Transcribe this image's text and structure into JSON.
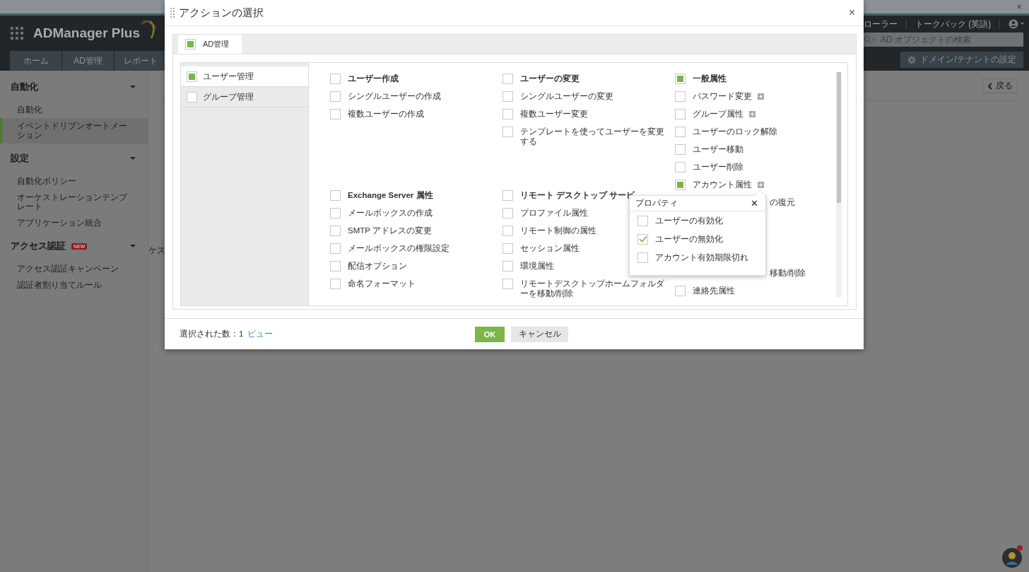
{
  "browser_strip": {
    "close": "×"
  },
  "header": {
    "logo": "ADManager Plus",
    "links": [
      "ローラー",
      "トークバック (英語)"
    ],
    "search": {
      "placeholder": "AD オブジェクトの検索"
    },
    "nav_tabs": [
      {
        "label": "ホーム",
        "selected": false
      },
      {
        "label": "AD管理",
        "selected": false
      },
      {
        "label": "レポート",
        "selected": false
      }
    ],
    "domain_button": "ドメイン/テナントの設定"
  },
  "sidebar": {
    "sections": [
      {
        "title": "自動化",
        "expanded": true,
        "items": [
          {
            "label": "自動化",
            "selected": false
          },
          {
            "label": "イベントドリブンオートメーション",
            "selected": true
          }
        ]
      },
      {
        "title": "設定",
        "expanded": true,
        "items": [
          {
            "label": "自動化ポリシー",
            "selected": false
          },
          {
            "label": "オーケストレーションテンプレート",
            "selected": false
          },
          {
            "label": "アプリケーション統合",
            "selected": false
          }
        ]
      },
      {
        "title": "アクセス認証",
        "badge": "NEW",
        "expanded": true,
        "items": [
          {
            "label": "アクセス認証キャンペーン",
            "selected": false
          },
          {
            "label": "認証者割り当てルール",
            "selected": false
          }
        ]
      }
    ]
  },
  "content": {
    "partial_texts": [
      "ケス"
    ],
    "back_button": "戻る"
  },
  "dialog": {
    "title": "アクションの選択",
    "close": "×",
    "tabs": [
      {
        "label": "AD管理",
        "checked": true,
        "selected": true
      }
    ],
    "categories": [
      {
        "label": "ユーザー管理",
        "checked": true,
        "selected": true
      },
      {
        "label": "グループ管理",
        "checked": false,
        "selected": false
      }
    ],
    "columns": [
      {
        "groups": [
          {
            "title": "ユーザー作成",
            "checked": false,
            "items": [
              {
                "kind": "checkbox",
                "label": "シングルユーザーの作成",
                "checked": false
              },
              {
                "kind": "checkbox",
                "label": "複数ユーザーの作成",
                "checked": false
              }
            ]
          },
          {
            "title": "Exchange Server 属性",
            "checked": false,
            "items": [
              {
                "kind": "checkbox",
                "label": "メールボックスの作成",
                "checked": false
              },
              {
                "kind": "checkbox",
                "label": "SMTP アドレスの変更",
                "checked": false
              },
              {
                "kind": "checkbox",
                "label": "メールボックスの権限設定",
                "checked": false
              },
              {
                "kind": "checkbox",
                "label": "配信オプション",
                "checked": false
              },
              {
                "kind": "checkbox",
                "label": "命名フォーマット",
                "checked": false
              }
            ]
          }
        ]
      },
      {
        "groups": [
          {
            "title": "ユーザーの変更",
            "checked": false,
            "items": [
              {
                "kind": "checkbox",
                "label": "シングルユーザーの変更",
                "checked": false
              },
              {
                "kind": "checkbox",
                "label": "複数ユーザー変更",
                "checked": false
              },
              {
                "kind": "checkbox",
                "label": "テンプレートを使ってユーザーを変更する",
                "checked": false
              }
            ]
          },
          {
            "title": "リモート デスクトップ サービ",
            "checked": false,
            "items": [
              {
                "kind": "checkbox",
                "label": "プロファイル属性",
                "checked": false
              },
              {
                "kind": "checkbox",
                "label": "リモート制御の属性",
                "checked": false
              },
              {
                "kind": "checkbox",
                "label": "セッション属性",
                "checked": false
              },
              {
                "kind": "checkbox",
                "label": "環境属性",
                "checked": false
              },
              {
                "kind": "checkbox",
                "label": "リモートデスクトップホームフォルダーを移動/削除",
                "checked": false
              }
            ]
          }
        ]
      },
      {
        "groups": [
          {
            "title": "一般属性",
            "checked": true,
            "items": [
              {
                "kind": "checkbox",
                "label": "パスワード変更",
                "checked": false,
                "expandable": true
              },
              {
                "kind": "checkbox",
                "label": "グループ属性",
                "checked": false,
                "expandable": true
              },
              {
                "kind": "checkbox",
                "label": "ユーザーのロック解除",
                "checked": false
              },
              {
                "kind": "checkbox",
                "label": "ユーザー移動",
                "checked": false
              },
              {
                "kind": "checkbox",
                "label": "ユーザー削除",
                "checked": false
              },
              {
                "kind": "checkbox",
                "label": "アカウント属性",
                "checked": true,
                "expandable": true
              },
              {
                "kind": "covered",
                "label": "の復元"
              },
              {
                "kind": "covered",
                "label": "移動/削除"
              },
              {
                "kind": "checkbox",
                "label": "連絡先属性",
                "checked": false
              }
            ]
          }
        ]
      }
    ],
    "popup": {
      "title": "プロパティ",
      "close": "✕",
      "items": [
        {
          "label": "ユーザーの有効化",
          "checked": false
        },
        {
          "label": "ユーザーの無効化",
          "checked": true
        },
        {
          "label": "アカウント有効期限切れ",
          "checked": false
        }
      ]
    },
    "footer": {
      "count_label": "選択された数：1",
      "view_link": "ビュー",
      "ok_button": "OK",
      "cancel_button": "キャンセル"
    }
  }
}
